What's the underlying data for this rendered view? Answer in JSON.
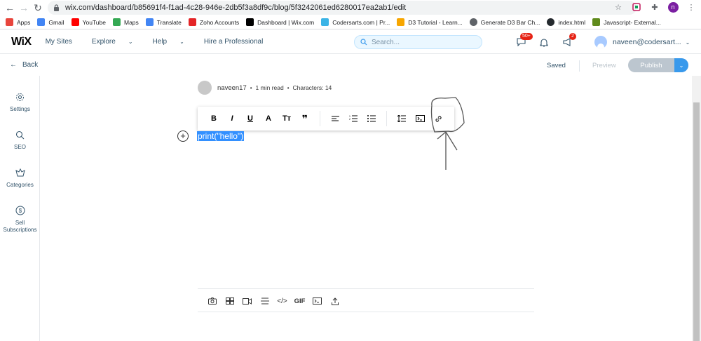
{
  "browser": {
    "url": "wix.com/dashboard/b85691f4-f1ad-4c28-946e-2db5f3a8df9c/blog/5f3242061ed6280017ea2ab1/edit",
    "profile_initial": "n"
  },
  "bookmarks": [
    {
      "label": "Apps",
      "icon": "apps-grid-icon",
      "color": "#e8453c"
    },
    {
      "label": "Gmail",
      "icon": "google-icon",
      "color": "#4285f4"
    },
    {
      "label": "YouTube",
      "icon": "youtube-icon",
      "color": "#ff0000"
    },
    {
      "label": "Maps",
      "icon": "maps-icon",
      "color": "#34a853"
    },
    {
      "label": "Translate",
      "icon": "translate-icon",
      "color": "#4285f4"
    },
    {
      "label": "Zoho Accounts",
      "icon": "zoho-icon",
      "color": "#e42527"
    },
    {
      "label": "Dashboard | Wix.com",
      "icon": "wix-icon",
      "color": "#000000"
    },
    {
      "label": "Codersarts.com | Pr...",
      "icon": "codersarts-icon",
      "color": "#3bb4e6"
    },
    {
      "label": "D3 Tutorial - Learn...",
      "icon": "d3-icon",
      "color": "#f7a600"
    },
    {
      "label": "Generate D3 Bar Ch...",
      "icon": "globe-icon",
      "color": "#5f6368"
    },
    {
      "label": "index.html",
      "icon": "github-icon",
      "color": "#24292e"
    },
    {
      "label": "Javascript- External...",
      "icon": "v-icon",
      "color": "#5f8a1c"
    }
  ],
  "wix": {
    "logo": "WiX",
    "nav": [
      {
        "label": "My Sites",
        "dropdown": false
      },
      {
        "label": "Explore",
        "dropdown": true
      },
      {
        "label": "Help",
        "dropdown": true
      },
      {
        "label": "Hire a Professional",
        "dropdown": false
      }
    ],
    "search_placeholder": "Search...",
    "messages_badge": "50+",
    "updates_badge": "2",
    "user_name": "naveen@codersart..."
  },
  "editor": {
    "back_label": "Back",
    "saved_label": "Saved",
    "preview_label": "Preview",
    "publish_label": "Publish"
  },
  "sidebar": [
    {
      "label": "Settings",
      "icon": "gear-icon"
    },
    {
      "label": "SEO",
      "icon": "search-icon"
    },
    {
      "label": "Categories",
      "icon": "categories-icon"
    },
    {
      "label": "Sell Subscriptions",
      "icon": "dollar-icon"
    }
  ],
  "post": {
    "author": "naveen17",
    "read_time": "1 min read",
    "characters": "Characters: 14",
    "content": "print(\"hello\")"
  },
  "format_toolbar": [
    "B",
    "I",
    "U",
    "A",
    "Tт",
    "❞"
  ],
  "insert_toolbar": {
    "gif_label": "GIF"
  },
  "colors": {
    "wix_blue": "#3899ec",
    "selection": "#3390ff",
    "text_dark": "#32536a"
  }
}
